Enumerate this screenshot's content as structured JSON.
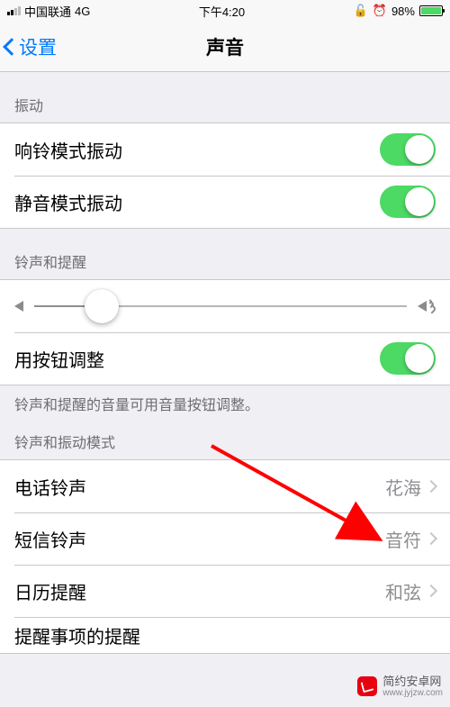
{
  "status": {
    "carrier": "中国联通",
    "network": "4G",
    "time": "下午4:20",
    "battery_pct": "98%"
  },
  "nav": {
    "back_label": "设置",
    "title": "声音"
  },
  "sections": {
    "vibrate": {
      "header": "振动",
      "ring_vibrate_label": "响铃模式振动",
      "ring_vibrate_on": true,
      "silent_vibrate_label": "静音模式振动",
      "silent_vibrate_on": true
    },
    "ringer": {
      "header": "铃声和提醒",
      "slider_value": 0.18,
      "change_with_buttons_label": "用按钮调整",
      "change_with_buttons_on": true,
      "footer": "铃声和提醒的音量可用音量按钮调整。"
    },
    "patterns": {
      "header": "铃声和振动模式",
      "ringtone_label": "电话铃声",
      "ringtone_value": "花海",
      "texttone_label": "短信铃声",
      "texttone_value": "音符",
      "calendar_label": "日历提醒",
      "calendar_value": "和弦",
      "reminder_label": "提醒事项的提醒"
    }
  },
  "watermark": {
    "title": "简约安卓网",
    "subtitle": "www.jyjzw.com"
  }
}
